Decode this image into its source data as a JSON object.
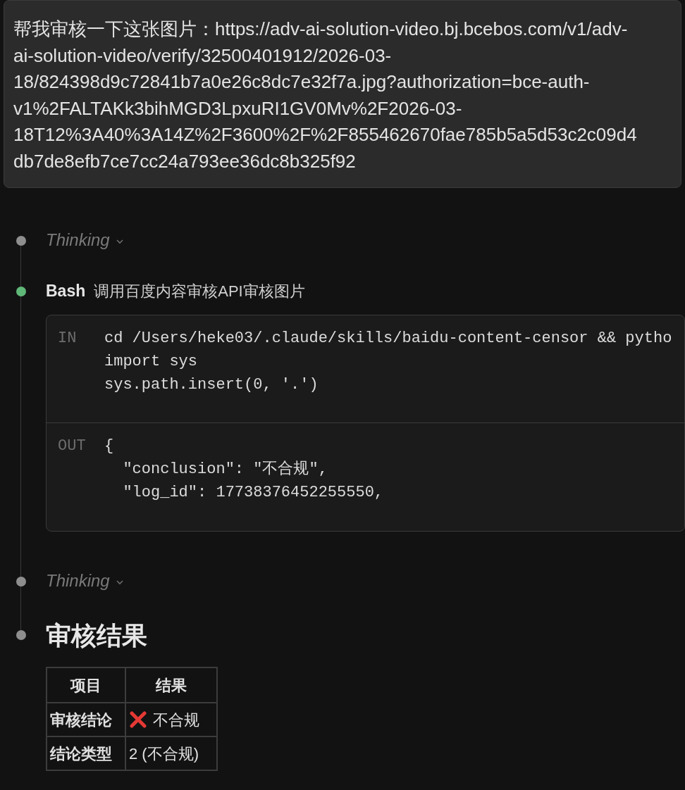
{
  "user_message": {
    "lines": [
      "帮我审核一下这张图片：https://adv-ai-solution-video.bj.bcebos.com/v1/adv-",
      "ai-solution-video/verify/32500401912/2026-03-",
      "18/824398d9c72841b7a0e26c8dc7e32f7a.jpg?authorization=bce-auth-",
      "v1%2FALTAKk3bihMGD3LpxuRI1GV0Mv%2F2026-03-",
      "18T12%3A40%3A14Z%2F3600%2F%2F855462670fae785b5a5d53c2c09d4",
      "db7de8efb7ce7cc24a793ee36dc8b325f92"
    ]
  },
  "steps": [
    {
      "kind": "thinking",
      "color": "#8e8e8e",
      "label": "Thinking",
      "expanded": false
    },
    {
      "kind": "tool",
      "color": "#5fb878",
      "tool": "Bash",
      "description": "调用百度内容审核API审核图片",
      "input_label": "IN",
      "input_lines": [
        "cd /Users/heke03/.claude/skills/baidu-content-censor && pytho",
        "import sys",
        "sys.path.insert(0, '.')"
      ],
      "output_label": "OUT",
      "output_lines": [
        "{",
        "  \"conclusion\": \"不合规\",",
        "  \"log_id\": 17738376452255550,"
      ]
    },
    {
      "kind": "thinking",
      "color": "#8e8e8e",
      "label": "Thinking",
      "expanded": false
    },
    {
      "kind": "result",
      "color": "#8e8e8e",
      "heading": "审核结果",
      "table": {
        "columns": [
          "项目",
          "结果"
        ],
        "rows": [
          {
            "item": "审核结论",
            "result": "不合规",
            "failed": true
          },
          {
            "item": "结论类型",
            "result": "2 (不合规)",
            "failed": false
          }
        ]
      }
    }
  ]
}
